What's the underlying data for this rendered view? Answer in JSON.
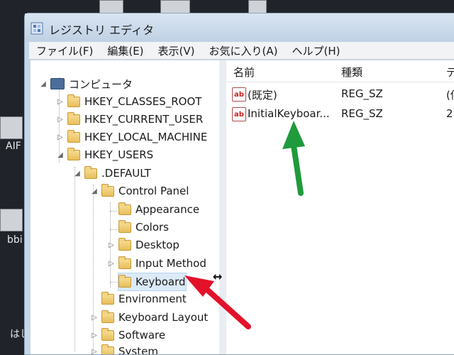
{
  "desktop": {
    "labels": [
      "AIF",
      "bbi",
      "はし"
    ]
  },
  "window": {
    "title": "レジストリ エディタ"
  },
  "menu": [
    "ファイル(F)",
    "編集(E)",
    "表示(V)",
    "お気に入り(A)",
    "ヘルプ(H)"
  ],
  "tree": {
    "root": "コンピュータ",
    "hives": [
      "HKEY_CLASSES_ROOT",
      "HKEY_CURRENT_USER",
      "HKEY_LOCAL_MACHINE",
      "HKEY_USERS"
    ],
    "default": ".DEFAULT",
    "control_panel": "Control Panel",
    "cp_children": [
      "Appearance",
      "Colors",
      "Desktop",
      "Input Method",
      "Keyboard"
    ],
    "default_children": [
      "Environment",
      "Keyboard Layout",
      "Software",
      "System"
    ]
  },
  "list": {
    "headers": [
      "名前",
      "種類",
      "デ"
    ],
    "rows": [
      {
        "name": "(既定)",
        "type": "REG_SZ",
        "data": "(値"
      },
      {
        "name": "InitialKeyboar...",
        "type": "REG_SZ",
        "data": "2"
      }
    ]
  },
  "colors": {
    "green_arrow": "#1f9a3c",
    "red_arrow": "#e3122a"
  }
}
